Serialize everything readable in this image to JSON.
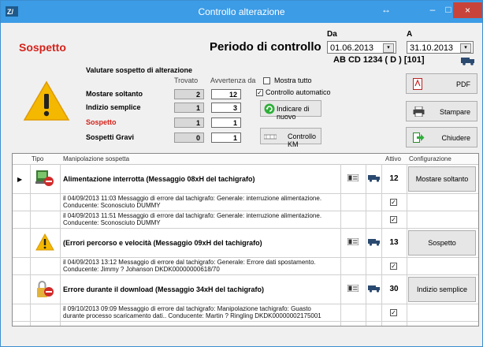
{
  "window": {
    "title": "Controllo alterazione",
    "buttons": {
      "resize": "↔",
      "minimize": "–",
      "maximize": "□",
      "close": "×"
    }
  },
  "header": {
    "status_title": "Sospetto",
    "period_title": "Periodo di controllo",
    "date_from": {
      "label": "Da",
      "value": "01.06.2013"
    },
    "date_to": {
      "label": "A",
      "value": "31.10.2013"
    },
    "vehicle": "AB CD 1234 ( D ) [101]"
  },
  "evaluation": {
    "title": "Valutare sospetto di alterazione",
    "col_found": "Trovato",
    "col_warning": "Avvertenza da",
    "rows": [
      {
        "label": "Mostare soltanto",
        "found": "2",
        "warning": "12",
        "red": false
      },
      {
        "label": "Indizio semplice",
        "found": "1",
        "warning": "3",
        "red": false
      },
      {
        "label": "Sospetto",
        "found": "1",
        "warning": "1",
        "red": true
      },
      {
        "label": "Sospetti Gravi",
        "found": "0",
        "warning": "1",
        "red": false
      }
    ],
    "show_all": {
      "label": "Mostra tutto",
      "checked": false
    },
    "auto_check": {
      "label": "Controllo automatico",
      "checked": true
    },
    "reindicate_button": "Indicare di nuovo",
    "km_button": "Controllo KM"
  },
  "actions": {
    "pdf": "PDF",
    "print": "Stampare",
    "close": "Chiudere"
  },
  "grid": {
    "headers": {
      "type": "Tipo",
      "manip": "Manipolazione sospetta",
      "active": "Attivo",
      "config": "Configurazione"
    },
    "groups": [
      {
        "icon": "power-interrupt-icon",
        "title": "Alimentazione interrotta (Messaggio 08xH del tachigrafo)",
        "count": "12",
        "config": "Mostare soltanto",
        "details": [
          {
            "line1": "il 04/09/2013 11:03 Messaggio di errore dal tachigrafo: Generale: interruzione alimentazione.",
            "line2": "Conducente: Sconosciuto DUMMY",
            "checked": true
          },
          {
            "line1": "il 04/09/2013 11:51 Messaggio di errore dal tachigrafo: Generale: interruzione alimentazione.",
            "line2": "Conducente: Sconosciuto DUMMY",
            "checked": true
          }
        ]
      },
      {
        "icon": "warning-icon",
        "title": "(Errori percorso e velocità (Messaggio 09xH del tachigrafo)",
        "count": "13",
        "config": "Sospetto",
        "details": [
          {
            "line1": "il 04/09/2013 13:12 Messaggio di errore dal tachigrafo: Generale: Errore dati spostamento.",
            "line2": "Conducente: Jimmy ? Johanson DKDK00000000618/70",
            "checked": true
          }
        ]
      },
      {
        "icon": "download-error-icon",
        "title": "Errore durante il download (Messaggio 34xH del tachigrafo)",
        "count": "30",
        "config": "Indizio semplice",
        "details": [
          {
            "line1": "il 09/10/2013 09:09 Messaggio di errore dal tachigrafo: Manipolazione tachigrafo: Guasto",
            "line2": "durante processo scaricamento dati.. Conducente: Martin ? Ringling DKDK00000002175001",
            "checked": true
          }
        ]
      }
    ]
  }
}
